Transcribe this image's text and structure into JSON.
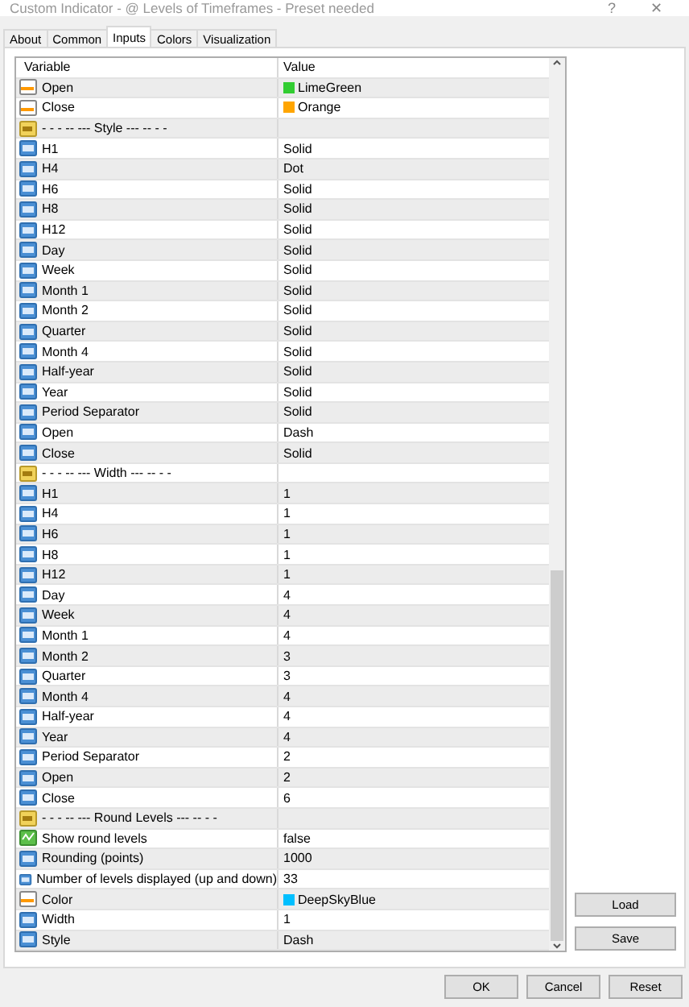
{
  "window": {
    "title": "Custom Indicator - @ Levels of Timeframes - Preset needed",
    "help": "?",
    "close": "✕"
  },
  "tabs": [
    {
      "label": "About",
      "selected": false
    },
    {
      "label": "Common",
      "selected": false
    },
    {
      "label": "Inputs",
      "selected": true
    },
    {
      "label": "Colors",
      "selected": false
    },
    {
      "label": "Visualization",
      "selected": false
    }
  ],
  "table": {
    "columns": [
      "Variable",
      "Value"
    ],
    "rows": [
      {
        "kind": "color",
        "variable": "Open",
        "value": "LimeGreen",
        "color": "#32cd32"
      },
      {
        "kind": "color",
        "variable": "Close",
        "value": "Orange",
        "color": "#ffa500"
      },
      {
        "kind": "header",
        "variable": "-   -  - -- --- Style --- -- -  -"
      },
      {
        "kind": "number",
        "variable": "H1",
        "value": "Solid"
      },
      {
        "kind": "number",
        "variable": "H4",
        "value": "Dot"
      },
      {
        "kind": "number",
        "variable": "H6",
        "value": "Solid"
      },
      {
        "kind": "number",
        "variable": "H8",
        "value": "Solid"
      },
      {
        "kind": "number",
        "variable": "H12",
        "value": "Solid"
      },
      {
        "kind": "number",
        "variable": "Day",
        "value": "Solid"
      },
      {
        "kind": "number",
        "variable": "Week",
        "value": "Solid"
      },
      {
        "kind": "number",
        "variable": "Month 1",
        "value": "Solid"
      },
      {
        "kind": "number",
        "variable": "Month 2",
        "value": "Solid"
      },
      {
        "kind": "number",
        "variable": "Quarter",
        "value": "Solid"
      },
      {
        "kind": "number",
        "variable": "Month 4",
        "value": "Solid"
      },
      {
        "kind": "number",
        "variable": "Half-year",
        "value": "Solid"
      },
      {
        "kind": "number",
        "variable": "Year",
        "value": "Solid"
      },
      {
        "kind": "number",
        "variable": "Period Separator",
        "value": "Solid"
      },
      {
        "kind": "number",
        "variable": "Open",
        "value": "Dash"
      },
      {
        "kind": "number",
        "variable": "Close",
        "value": "Solid"
      },
      {
        "kind": "header",
        "variable": "-   -  - -- --- Width --- -- -  -"
      },
      {
        "kind": "number",
        "variable": "H1",
        "value": "1"
      },
      {
        "kind": "number",
        "variable": "H4",
        "value": "1"
      },
      {
        "kind": "number",
        "variable": "H6",
        "value": "1"
      },
      {
        "kind": "number",
        "variable": "H8",
        "value": "1"
      },
      {
        "kind": "number",
        "variable": "H12",
        "value": "1"
      },
      {
        "kind": "number",
        "variable": "Day",
        "value": "4"
      },
      {
        "kind": "number",
        "variable": "Week",
        "value": "4"
      },
      {
        "kind": "number",
        "variable": "Month 1",
        "value": "4"
      },
      {
        "kind": "number",
        "variable": "Month 2",
        "value": "3"
      },
      {
        "kind": "number",
        "variable": "Quarter",
        "value": "3"
      },
      {
        "kind": "number",
        "variable": "Month 4",
        "value": "4"
      },
      {
        "kind": "number",
        "variable": "Half-year",
        "value": "4"
      },
      {
        "kind": "number",
        "variable": "Year",
        "value": "4"
      },
      {
        "kind": "number",
        "variable": "Period Separator",
        "value": "2"
      },
      {
        "kind": "number",
        "variable": "Open",
        "value": "2"
      },
      {
        "kind": "number",
        "variable": "Close",
        "value": "6"
      },
      {
        "kind": "header",
        "variable": "-   -  - -- --- Round Levels --- -- -  -"
      },
      {
        "kind": "bool",
        "variable": "Show round levels",
        "value": "false"
      },
      {
        "kind": "number",
        "variable": "Rounding (points)",
        "value": "1000"
      },
      {
        "kind": "number",
        "variable": "Number of levels displayed (up and down)",
        "value": "33"
      },
      {
        "kind": "color",
        "variable": "Color",
        "value": "DeepSkyBlue",
        "color": "#00bfff"
      },
      {
        "kind": "number",
        "variable": "Width",
        "value": "1"
      },
      {
        "kind": "number",
        "variable": "Style",
        "value": "Dash"
      }
    ]
  },
  "side_buttons": [
    "Load",
    "Save"
  ],
  "buttons": [
    "OK",
    "Cancel",
    "Reset"
  ]
}
